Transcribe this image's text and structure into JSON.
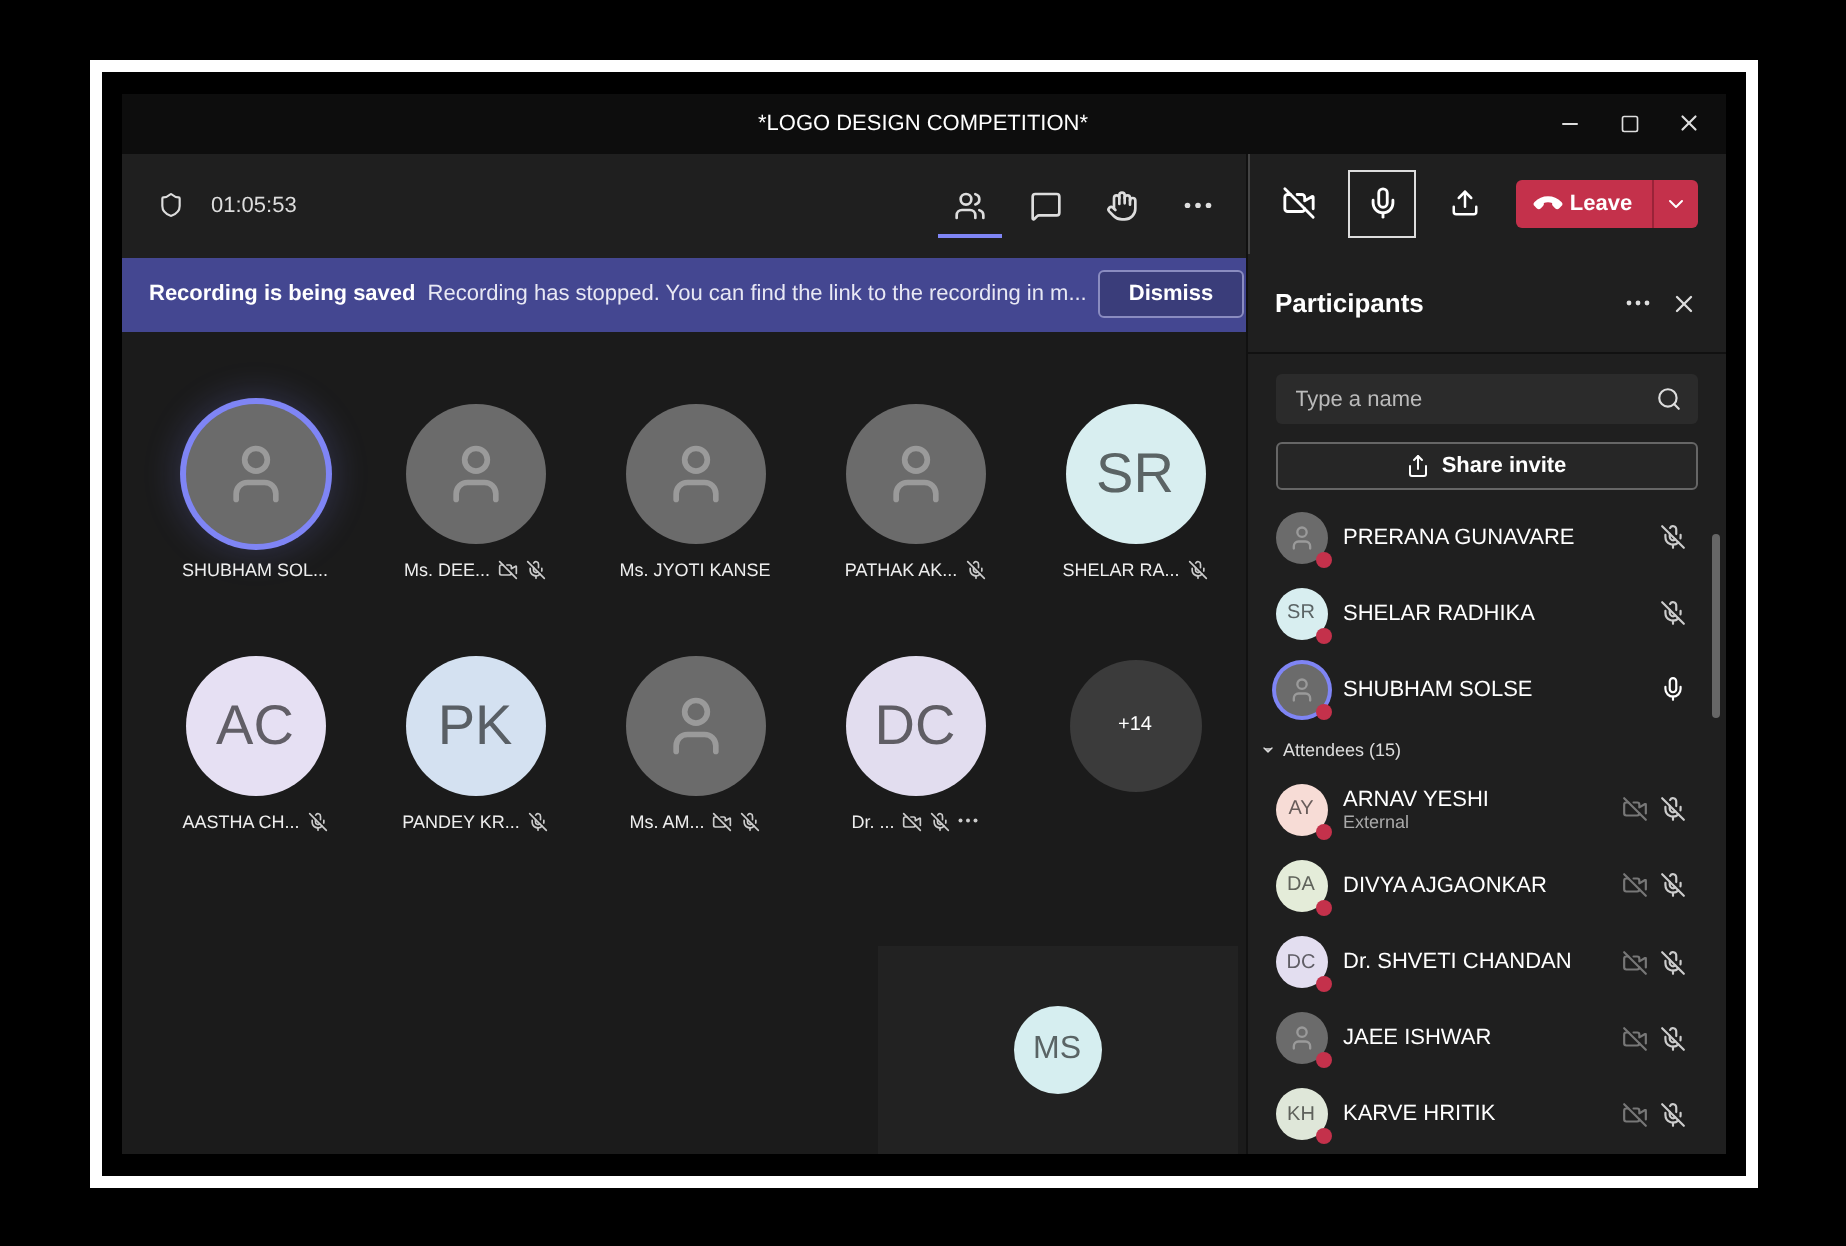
{
  "window": {
    "title": "*LOGO DESIGN COMPETITION*"
  },
  "meeting_bar": {
    "timer": "01:05:53",
    "tools": [
      {
        "kind": "people",
        "selected": true
      },
      {
        "kind": "chat",
        "selected": false
      },
      {
        "kind": "hand",
        "selected": false
      },
      {
        "kind": "more",
        "selected": false
      }
    ],
    "controls": [
      {
        "kind": "camera-off",
        "focused": false
      },
      {
        "kind": "mic",
        "focused": true
      },
      {
        "kind": "share",
        "focused": false
      }
    ],
    "leave": {
      "label": "Leave"
    }
  },
  "banner": {
    "title": "Recording is being saved",
    "message": "Recording has stopped. You can find the link to the recording in m...",
    "button": "Dismiss"
  },
  "tiles": [
    {
      "name": "SHUBHAM SOL...",
      "avatar": {
        "kind": "photo"
      },
      "speaking": true,
      "muted": false,
      "camera_off": false,
      "more_menu": false
    },
    {
      "name": "Ms. DEE...",
      "avatar": {
        "kind": "photo"
      },
      "speaking": false,
      "muted": true,
      "camera_off": true,
      "more_menu": false
    },
    {
      "name": "Ms. JYOTI KANSE",
      "avatar": {
        "kind": "photo"
      },
      "speaking": false,
      "muted": false,
      "camera_off": false,
      "more_menu": false
    },
    {
      "name": "PATHAK AK...",
      "avatar": {
        "kind": "photo"
      },
      "speaking": false,
      "muted": true,
      "camera_off": false,
      "more_menu": false
    },
    {
      "name": "SHELAR RA...",
      "avatar": {
        "kind": "initials",
        "initials": "SR",
        "color": "#d8eef0"
      },
      "speaking": false,
      "muted": true,
      "camera_off": false,
      "more_menu": false
    },
    {
      "name": "AASTHA CH...",
      "avatar": {
        "kind": "initials",
        "initials": "AC",
        "color": "#e6e0f3"
      },
      "speaking": false,
      "muted": true,
      "camera_off": false,
      "more_menu": false
    },
    {
      "name": "PANDEY KR...",
      "avatar": {
        "kind": "initials",
        "initials": "PK",
        "color": "#d4e1f1"
      },
      "speaking": false,
      "muted": true,
      "camera_off": false,
      "more_menu": false
    },
    {
      "name": "Ms. AM...",
      "avatar": {
        "kind": "photo"
      },
      "speaking": false,
      "muted": true,
      "camera_off": true,
      "more_menu": false
    },
    {
      "name": "Dr. ...",
      "avatar": {
        "kind": "initials",
        "initials": "DC",
        "color": "#e2ddef"
      },
      "speaking": false,
      "muted": true,
      "camera_off": true,
      "more_menu": true
    }
  ],
  "overflow": {
    "count": "+14"
  },
  "self_view": {
    "initials": "MS",
    "color": "#d6eef0"
  },
  "panel": {
    "title": "Participants",
    "search": {
      "placeholder": "Type a name"
    },
    "share_button": "Share invite",
    "presenters": [
      {
        "name": "PRERANA GUNAVARE",
        "avatar": {
          "kind": "photo"
        },
        "muted": true,
        "camera_off": false
      },
      {
        "name": "SHELAR RADHIKA",
        "avatar": {
          "kind": "initials",
          "initials": "SR",
          "color": "#d8eef0"
        },
        "muted": true,
        "camera_off": false
      },
      {
        "name": "SHUBHAM SOLSE",
        "avatar": {
          "kind": "photo"
        },
        "muted": false,
        "camera_off": false,
        "speaking": true
      }
    ],
    "attendees_header": {
      "label": "Attendees (15)",
      "expanded": true
    },
    "attendees": [
      {
        "name": "ARNAV YESHI",
        "subtitle": "External",
        "avatar": {
          "kind": "initials",
          "initials": "AY",
          "color": "#f7dcd6"
        },
        "muted": true,
        "camera_off": true
      },
      {
        "name": "DIVYA AJGAONKAR",
        "avatar": {
          "kind": "initials",
          "initials": "DA",
          "color": "#e4ecd9"
        },
        "muted": true,
        "camera_off": true
      },
      {
        "name": "Dr. SHVETI CHANDAN",
        "avatar": {
          "kind": "initials",
          "initials": "DC",
          "color": "#e3def0"
        },
        "muted": true,
        "camera_off": true
      },
      {
        "name": "JAEE ISHWAR",
        "avatar": {
          "kind": "photo"
        },
        "muted": true,
        "camera_off": true
      },
      {
        "name": "KARVE HRITIK",
        "avatar": {
          "kind": "initials",
          "initials": "KH",
          "color": "#dfe7d9"
        },
        "muted": true,
        "camera_off": true
      }
    ]
  }
}
